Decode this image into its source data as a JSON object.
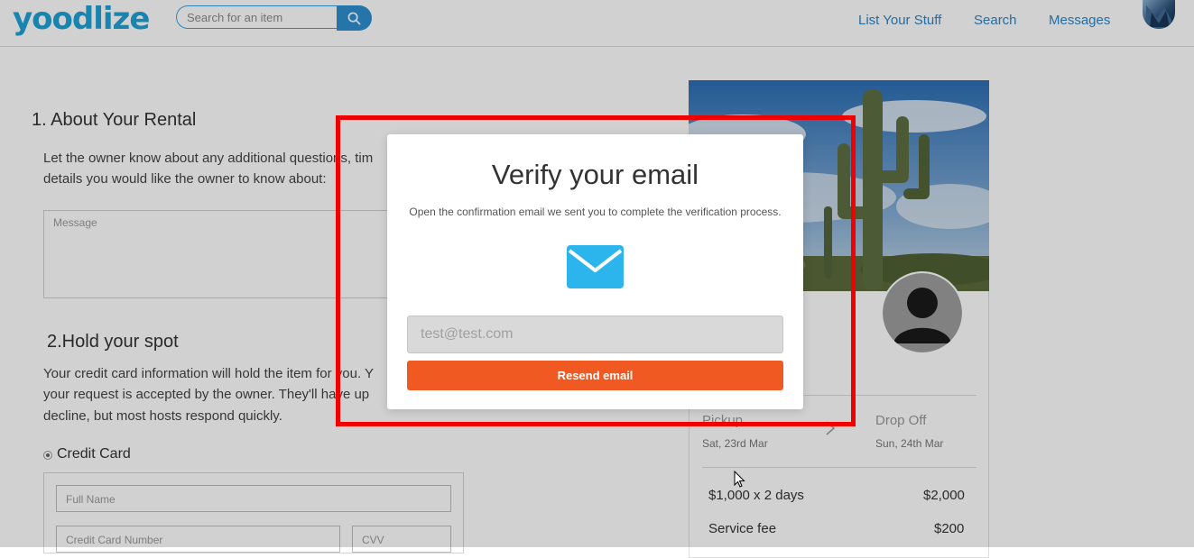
{
  "header": {
    "logo": "yoodlize",
    "search": {
      "placeholder": "Search for an item"
    },
    "nav": [
      "List Your Stuff",
      "Search",
      "Messages"
    ]
  },
  "rental": {
    "title": "1. About Your Rental",
    "desc_line1": "Let the owner know about any additional questions, tim",
    "desc_line2": "details you would like the owner to know about:",
    "message_placeholder": "Message"
  },
  "hold": {
    "title": "2.Hold your spot",
    "line1": "Your credit card information will hold the item for you. Y",
    "line2": "your request is accepted by the owner. They'll have up",
    "line3": "decline, but most hosts respond quickly.",
    "payment_option": "Credit Card",
    "full_name_placeholder": "Full Name",
    "card_number_placeholder": "Credit Card Number",
    "cvv_placeholder": "CVV"
  },
  "booking": {
    "pickup_label": "Pickup",
    "pickup_date": "Sat, 23rd Mar",
    "dropoff_label": "Drop Off",
    "dropoff_date": "Sun, 24th Mar",
    "rate_line": "$1,000 x 2 days",
    "rate_total": "$2,000",
    "fee_label": "Service fee",
    "fee_value": "$200"
  },
  "modal": {
    "title": "Verify your email",
    "subtitle": "Open the confirmation email we sent you to complete the verification process.",
    "email_value": "test@test.com",
    "resend_label": "Resend email"
  },
  "colors": {
    "brand": "#1fa3d6",
    "link": "#2f86c6",
    "resend": "#f05a22",
    "mail_icon": "#2bb5ec",
    "highlight": "#ee0000"
  },
  "icons": [
    "search-icon",
    "mail-icon",
    "chevron-right-icon",
    "avatar-icon",
    "cursor-icon"
  ]
}
